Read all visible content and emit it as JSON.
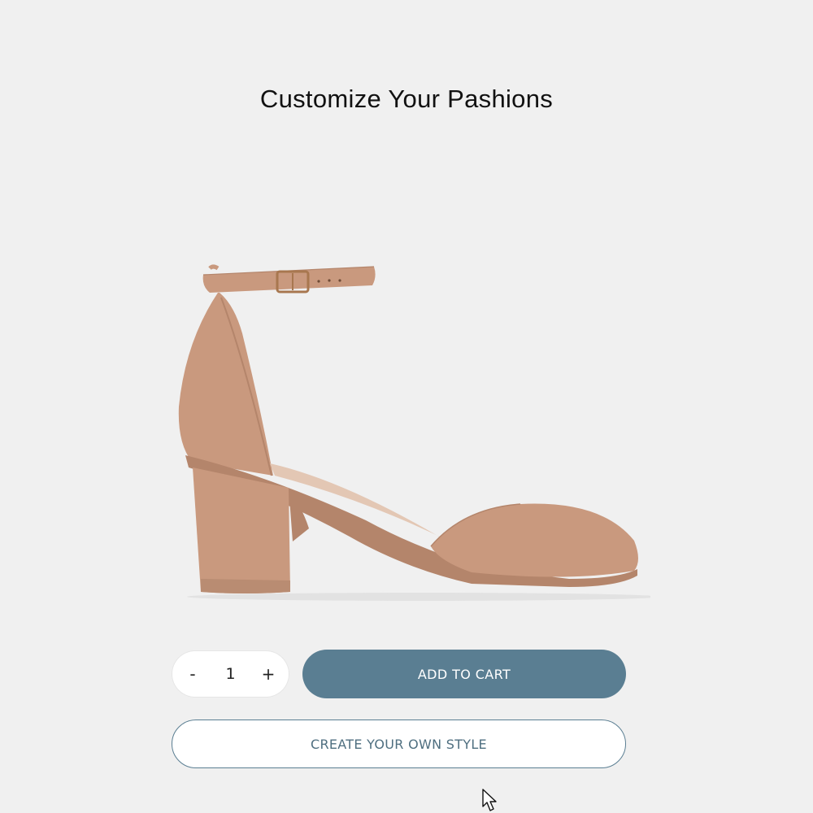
{
  "header": {
    "title": "Customize Your Pashions"
  },
  "product": {
    "image_icon": "shoe-image",
    "colors": {
      "leather": "#c9997e",
      "leather_shadow": "#b4856b",
      "buckle": "#a8774f"
    }
  },
  "quantity": {
    "decrement_label": "-",
    "value": "1",
    "increment_label": "+"
  },
  "actions": {
    "add_to_cart_label": "ADD TO CART",
    "create_style_label": "CREATE YOUR OWN STYLE"
  },
  "theme": {
    "background": "#f0f0f0",
    "accent": "#5a7e92"
  }
}
